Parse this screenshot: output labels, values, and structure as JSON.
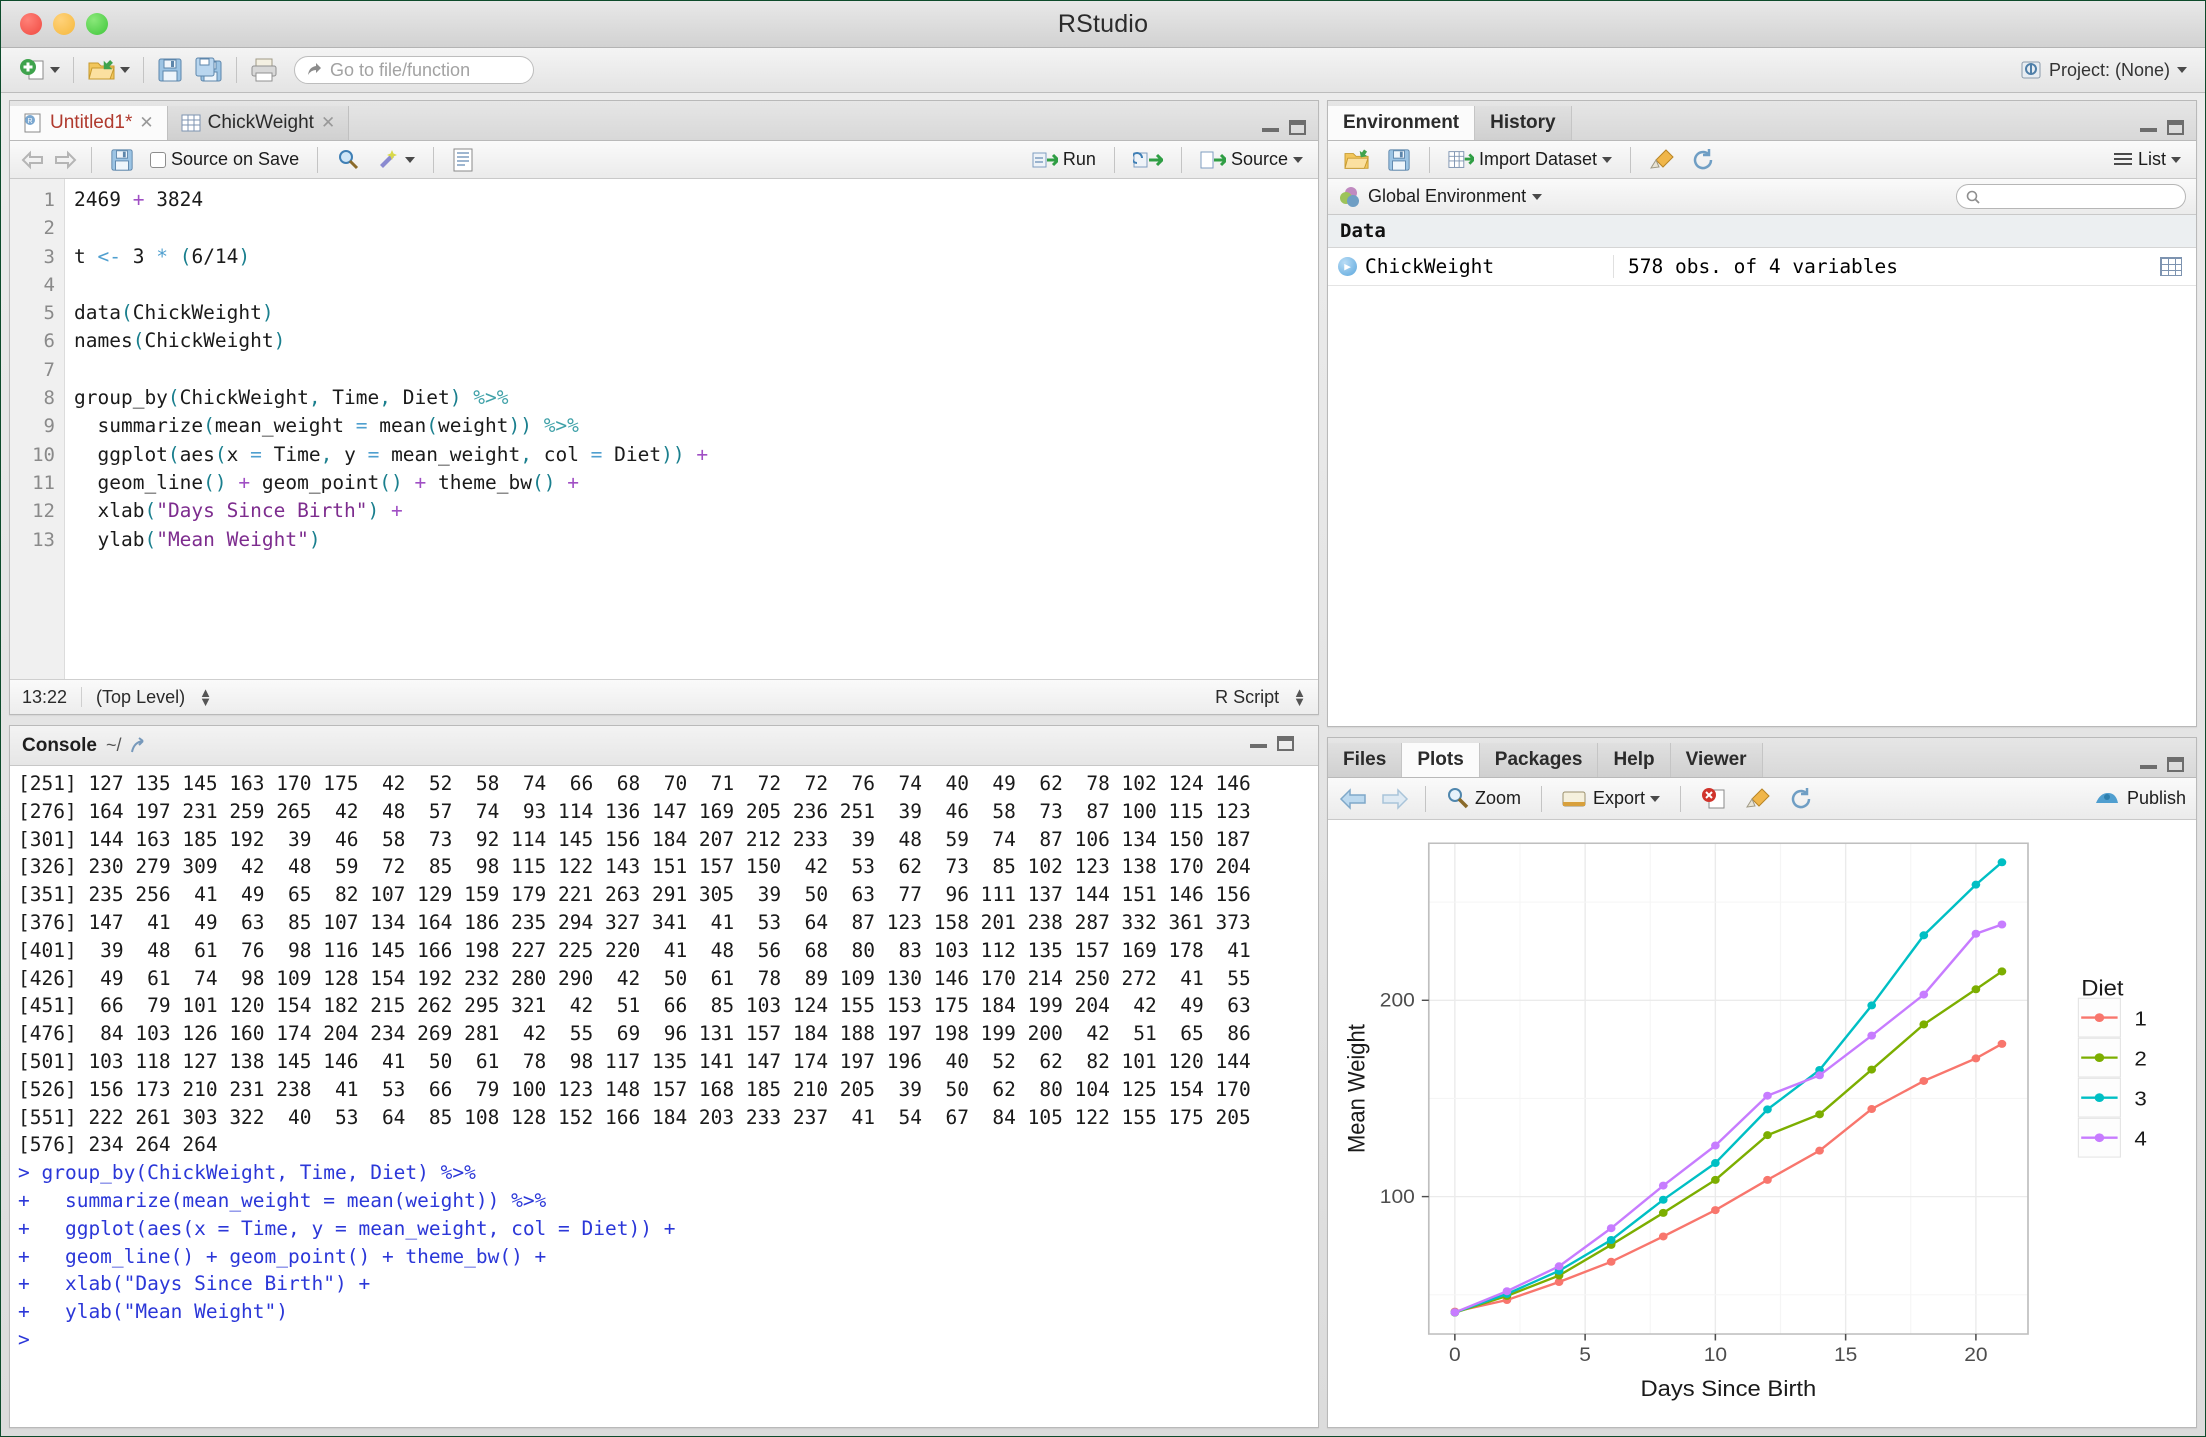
{
  "window": {
    "title": "RStudio"
  },
  "toolbar": {
    "new_file_icon": "new-document-icon",
    "open_icon": "open-folder-icon",
    "save_icon": "save-icon",
    "save_all_icon": "save-all-icon",
    "print_icon": "print-icon",
    "goto_placeholder": "Go to file/function",
    "project_label": "Project: (None)"
  },
  "source_pane": {
    "tabs": [
      {
        "label": "Untitled1*",
        "icon": "r-script-icon",
        "modified": true,
        "active": true
      },
      {
        "label": "ChickWeight",
        "icon": "data-grid-icon",
        "modified": false,
        "active": false
      }
    ],
    "toolbar": {
      "back_icon": "arrow-left-icon",
      "forward_icon": "arrow-right-icon",
      "save_icon": "save-icon",
      "source_on_save_label": "Source on Save",
      "find_icon": "magnifier-icon",
      "wand_icon": "code-tools-icon",
      "compile_icon": "compile-report-icon",
      "run_label": "Run",
      "rerun_icon": "re-run-icon",
      "source_label": "Source"
    },
    "line_numbers": [
      "1",
      "2",
      "3",
      "4",
      "5",
      "6",
      "7",
      "8",
      "9",
      "10",
      "11",
      "12",
      "13"
    ],
    "code_lines": [
      "2469 + 3824",
      "",
      "t <- 3 * (6/14)",
      "",
      "data(ChickWeight)",
      "names(ChickWeight)",
      "",
      "group_by(ChickWeight, Time, Diet) %>%",
      "  summarize(mean_weight = mean(weight)) %>%",
      "  ggplot(aes(x = Time, y = mean_weight, col = Diet)) +",
      "  geom_line() + geom_point() + theme_bw() +",
      "  xlab(\"Days Since Birth\") +",
      "  ylab(\"Mean Weight\")"
    ],
    "status": {
      "cursor_position": "13:22",
      "scope": "(Top Level)",
      "file_type": "R Script"
    }
  },
  "console_pane": {
    "title": "Console",
    "working_dir": "~/",
    "popout_icon": "popout-icon",
    "output_rows": [
      {
        "index": "[251]",
        "values": [
          "127",
          "135",
          "145",
          "163",
          "170",
          "175",
          "42",
          "52",
          "58",
          "74",
          "66",
          "68",
          "70",
          "71",
          "72",
          "72",
          "76",
          "74",
          "40",
          "49",
          "62",
          "78",
          "102",
          "124",
          "146"
        ]
      },
      {
        "index": "[276]",
        "values": [
          "164",
          "197",
          "231",
          "259",
          "265",
          "42",
          "48",
          "57",
          "74",
          "93",
          "114",
          "136",
          "147",
          "169",
          "205",
          "236",
          "251",
          "39",
          "46",
          "58",
          "73",
          "87",
          "100",
          "115",
          "123"
        ]
      },
      {
        "index": "[301]",
        "values": [
          "144",
          "163",
          "185",
          "192",
          "39",
          "46",
          "58",
          "73",
          "92",
          "114",
          "145",
          "156",
          "184",
          "207",
          "212",
          "233",
          "39",
          "48",
          "59",
          "74",
          "87",
          "106",
          "134",
          "150",
          "187"
        ]
      },
      {
        "index": "[326]",
        "values": [
          "230",
          "279",
          "309",
          "42",
          "48",
          "59",
          "72",
          "85",
          "98",
          "115",
          "122",
          "143",
          "151",
          "157",
          "150",
          "42",
          "53",
          "62",
          "73",
          "85",
          "102",
          "123",
          "138",
          "170",
          "204"
        ]
      },
      {
        "index": "[351]",
        "values": [
          "235",
          "256",
          "41",
          "49",
          "65",
          "82",
          "107",
          "129",
          "159",
          "179",
          "221",
          "263",
          "291",
          "305",
          "39",
          "50",
          "63",
          "77",
          "96",
          "111",
          "137",
          "144",
          "151",
          "146",
          "156"
        ]
      },
      {
        "index": "[376]",
        "values": [
          "147",
          "41",
          "49",
          "63",
          "85",
          "107",
          "134",
          "164",
          "186",
          "235",
          "294",
          "327",
          "341",
          "41",
          "53",
          "64",
          "87",
          "123",
          "158",
          "201",
          "238",
          "287",
          "332",
          "361",
          "373"
        ]
      },
      {
        "index": "[401]",
        "values": [
          "39",
          "48",
          "61",
          "76",
          "98",
          "116",
          "145",
          "166",
          "198",
          "227",
          "225",
          "220",
          "41",
          "48",
          "56",
          "68",
          "80",
          "83",
          "103",
          "112",
          "135",
          "157",
          "169",
          "178",
          "41"
        ]
      },
      {
        "index": "[426]",
        "values": [
          "49",
          "61",
          "74",
          "98",
          "109",
          "128",
          "154",
          "192",
          "232",
          "280",
          "290",
          "42",
          "50",
          "61",
          "78",
          "89",
          "109",
          "130",
          "146",
          "170",
          "214",
          "250",
          "272",
          "41",
          "55"
        ]
      },
      {
        "index": "[451]",
        "values": [
          "66",
          "79",
          "101",
          "120",
          "154",
          "182",
          "215",
          "262",
          "295",
          "321",
          "42",
          "51",
          "66",
          "85",
          "103",
          "124",
          "155",
          "153",
          "175",
          "184",
          "199",
          "204",
          "42",
          "49",
          "63"
        ]
      },
      {
        "index": "[476]",
        "values": [
          "84",
          "103",
          "126",
          "160",
          "174",
          "204",
          "234",
          "269",
          "281",
          "42",
          "55",
          "69",
          "96",
          "131",
          "157",
          "184",
          "188",
          "197",
          "198",
          "199",
          "200",
          "42",
          "51",
          "65",
          "86"
        ]
      },
      {
        "index": "[501]",
        "values": [
          "103",
          "118",
          "127",
          "138",
          "145",
          "146",
          "41",
          "50",
          "61",
          "78",
          "98",
          "117",
          "135",
          "141",
          "147",
          "174",
          "197",
          "196",
          "40",
          "52",
          "62",
          "82",
          "101",
          "120",
          "144"
        ]
      },
      {
        "index": "[526]",
        "values": [
          "156",
          "173",
          "210",
          "231",
          "238",
          "41",
          "53",
          "66",
          "79",
          "100",
          "123",
          "148",
          "157",
          "168",
          "185",
          "210",
          "205",
          "39",
          "50",
          "62",
          "80",
          "104",
          "125",
          "154",
          "170"
        ]
      },
      {
        "index": "[551]",
        "values": [
          "222",
          "261",
          "303",
          "322",
          "40",
          "53",
          "64",
          "85",
          "108",
          "128",
          "152",
          "166",
          "184",
          "203",
          "233",
          "237",
          "41",
          "54",
          "67",
          "84",
          "105",
          "122",
          "155",
          "175",
          "205"
        ]
      },
      {
        "index": "[576]",
        "values": [
          "234",
          "264",
          "264"
        ]
      }
    ],
    "command_lines": [
      {
        "prompt": ">",
        "text": "group_by(ChickWeight, Time, Diet) %>%"
      },
      {
        "prompt": "+",
        "text": "  summarize(mean_weight = mean(weight)) %>%"
      },
      {
        "prompt": "+",
        "text": "  ggplot(aes(x = Time, y = mean_weight, col = Diet)) +"
      },
      {
        "prompt": "+",
        "text": "  geom_line() + geom_point() + theme_bw() +"
      },
      {
        "prompt": "+",
        "text": "  xlab(\"Days Since Birth\") +"
      },
      {
        "prompt": "+",
        "text": "  ylab(\"Mean Weight\")"
      },
      {
        "prompt": ">",
        "text": ""
      }
    ]
  },
  "environment_pane": {
    "tabs": [
      {
        "label": "Environment",
        "active": true
      },
      {
        "label": "History",
        "active": false
      }
    ],
    "toolbar": {
      "load_icon": "open-folder-icon",
      "save_icon": "save-icon",
      "import_label": "Import Dataset",
      "broom_icon": "clear-broom-icon",
      "refresh_icon": "refresh-icon",
      "list_label": "List"
    },
    "scope_label": "Global Environment",
    "search_placeholder": "",
    "group_label": "Data",
    "rows": [
      {
        "name": "ChickWeight",
        "value": "578 obs. of 4 variables",
        "grid_icon": "view-data-icon"
      }
    ]
  },
  "plot_pane": {
    "tabs": [
      {
        "label": "Files",
        "active": false
      },
      {
        "label": "Plots",
        "active": true
      },
      {
        "label": "Packages",
        "active": false
      },
      {
        "label": "Help",
        "active": false
      },
      {
        "label": "Viewer",
        "active": false
      }
    ],
    "toolbar": {
      "back_icon": "arrow-left-icon",
      "forward_icon": "arrow-right-icon",
      "zoom_label": "Zoom",
      "export_label": "Export",
      "remove_icon": "remove-plot-icon",
      "clear_icon": "clear-broom-icon",
      "refresh_icon": "refresh-icon",
      "publish_label": "Publish",
      "publish_icon": "publish-icon"
    }
  },
  "chart_data": {
    "type": "line",
    "title": "",
    "xlabel": "Days Since Birth",
    "ylabel": "Mean Weight",
    "x": [
      0,
      2,
      4,
      6,
      8,
      10,
      12,
      14,
      16,
      18,
      20,
      21
    ],
    "xlim": [
      -1,
      22
    ],
    "ylim": [
      30,
      280
    ],
    "xticks": [
      0,
      5,
      10,
      15,
      20
    ],
    "yticks": [
      100,
      200
    ],
    "grid": true,
    "legend_title": "Diet",
    "legend_position": "right",
    "theme": "theme_bw",
    "series": [
      {
        "name": "1",
        "color": "#F8766D",
        "values": [
          41.4,
          47.3,
          56.5,
          66.8,
          79.7,
          93.1,
          108.5,
          123.4,
          144.6,
          158.9,
          170.4,
          177.8
        ]
      },
      {
        "name": "2",
        "color": "#7CAE00",
        "values": [
          40.9,
          49.4,
          59.8,
          75.4,
          91.7,
          108.5,
          131.3,
          141.9,
          164.7,
          187.7,
          205.6,
          214.7
        ]
      },
      {
        "name": "3",
        "color": "#00BFC4",
        "values": [
          41.0,
          50.4,
          62.2,
          77.9,
          98.4,
          117.1,
          144.4,
          164.5,
          197.4,
          233.1,
          258.9,
          270.3
        ]
      },
      {
        "name": "4",
        "color": "#C77CFF",
        "values": [
          41.0,
          51.8,
          64.5,
          83.9,
          105.6,
          126.0,
          151.4,
          161.8,
          182.0,
          202.9,
          233.9,
          238.6
        ]
      }
    ]
  }
}
